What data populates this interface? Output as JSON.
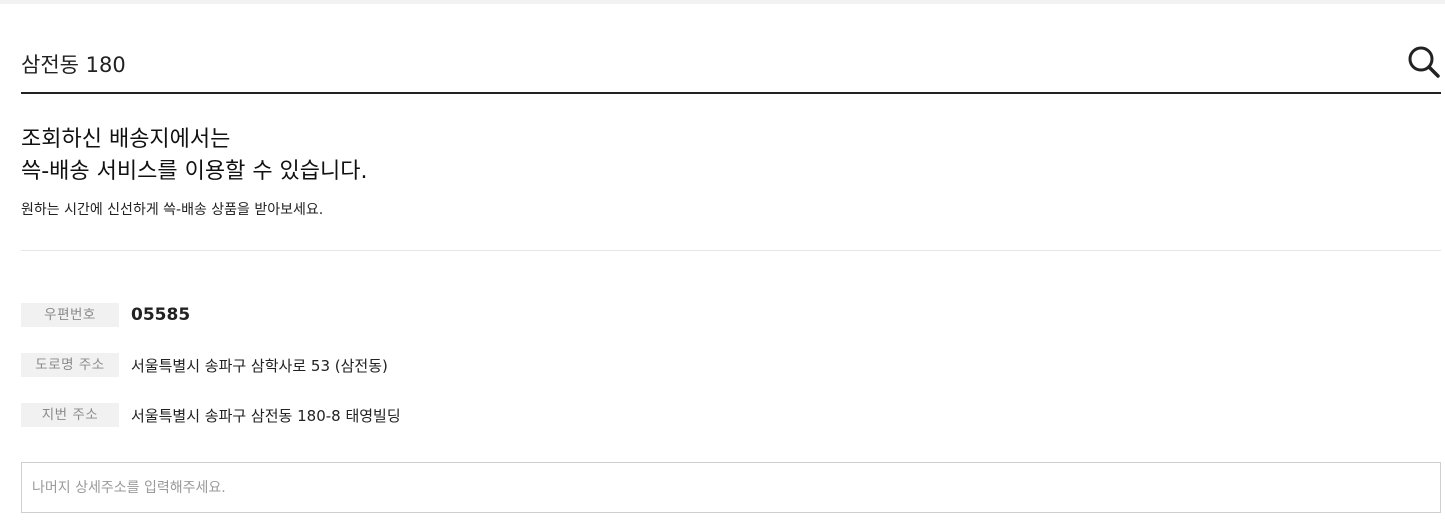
{
  "search": {
    "value": "삼전동 180",
    "icon": "search-icon"
  },
  "result": {
    "headline_line1": "조회하신 배송지에서는",
    "headline_line2": "쓱-배송 서비스를 이용할 수 있습니다.",
    "subtext": "원하는 시간에 신선하게 쓱-배송 상품을 받아보세요."
  },
  "address": {
    "postal_label": "우편번호",
    "postal_value": "05585",
    "road_label": "도로명 주소",
    "road_value": "서울특별시 송파구 삼학사로 53 (삼전동)",
    "lot_label": "지번 주소",
    "lot_value": "서울특별시 송파구 삼전동 180-8 태영빌딩"
  },
  "detail": {
    "placeholder": "나머지 상세주소를 입력해주세요."
  }
}
